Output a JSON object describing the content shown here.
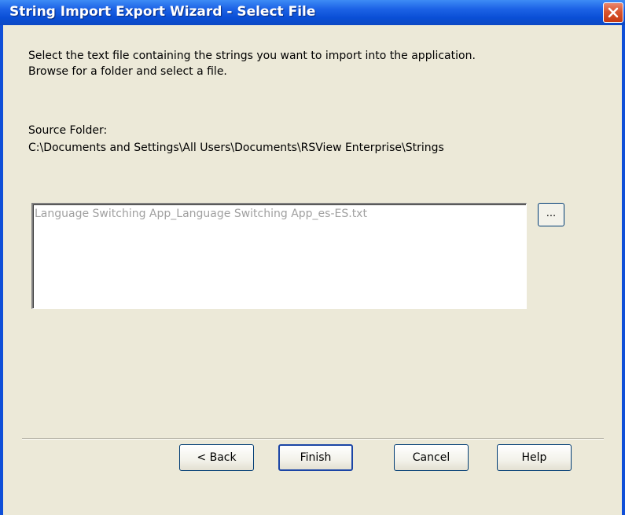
{
  "window": {
    "title": "String Import Export Wizard - Select File"
  },
  "instructions": {
    "line1": "Select the text file containing the strings you want to import into the application.",
    "line2": "Browse for a folder and select a file."
  },
  "source": {
    "label": "Source Folder:",
    "path": "C:\\Documents and Settings\\All Users\\Documents\\RSView Enterprise\\Strings"
  },
  "file_list": {
    "items": [
      "Language Switching App_Language Switching App_es-ES.txt"
    ]
  },
  "browse_button": {
    "label": "..."
  },
  "buttons": {
    "back": "< Back",
    "finish": "Finish",
    "cancel": "Cancel",
    "help": "Help"
  },
  "colors": {
    "titlebar": "#0a4fd6",
    "client_bg": "#ece9d8",
    "close_button": "#d9552f",
    "disabled_text": "#a0a0a0"
  },
  "icons": {
    "close": "close-icon"
  }
}
